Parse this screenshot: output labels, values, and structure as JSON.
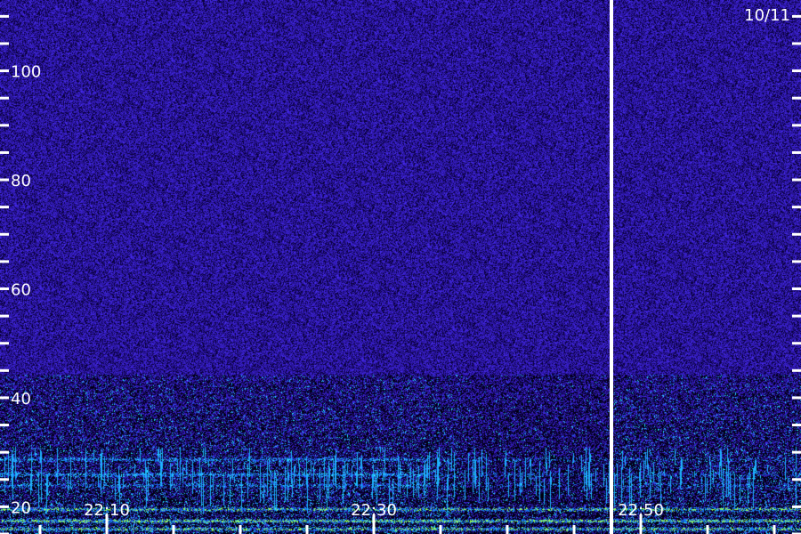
{
  "chart_data": {
    "type": "heatmap",
    "title": "",
    "date_label": "10/11",
    "y_axis": {
      "range": [
        15,
        113
      ],
      "tick_labels": [
        "20",
        "40",
        "60",
        "80",
        "100"
      ],
      "tick_values": [
        20,
        40,
        60,
        80,
        100
      ],
      "minor_ticks": [
        15,
        25,
        30,
        35,
        45,
        50,
        55,
        65,
        70,
        75,
        85,
        90,
        95,
        105,
        110
      ]
    },
    "x_axis": {
      "range_minutes": [
        22.0,
        82.0
      ],
      "tick_labels": [
        "22:10",
        "22:30",
        "22:50"
      ],
      "tick_values_minutes": [
        30,
        50,
        70
      ],
      "minor_ticks_minutes": [
        25,
        35,
        40,
        45,
        55,
        60,
        65,
        75,
        80
      ]
    },
    "marker_line_minutes": 67.8,
    "colormap": [
      "#000000",
      "#1a0a6e",
      "#2a1aa8",
      "#3a2ee0",
      "#1050e0",
      "#00a0ff",
      "#30e0ff",
      "#80ff60",
      "#d8ff40"
    ],
    "background_color": "#2a1496",
    "bands": [
      {
        "y": 28.7,
        "intensity": 0.55
      },
      {
        "y": 26.0,
        "intensity": 0.6
      },
      {
        "y": 24.0,
        "intensity": 0.45
      },
      {
        "y": 19.5,
        "intensity": 0.75
      },
      {
        "y": 17.4,
        "intensity": 0.9
      },
      {
        "y": 16.0,
        "intensity": 0.8
      }
    ]
  }
}
